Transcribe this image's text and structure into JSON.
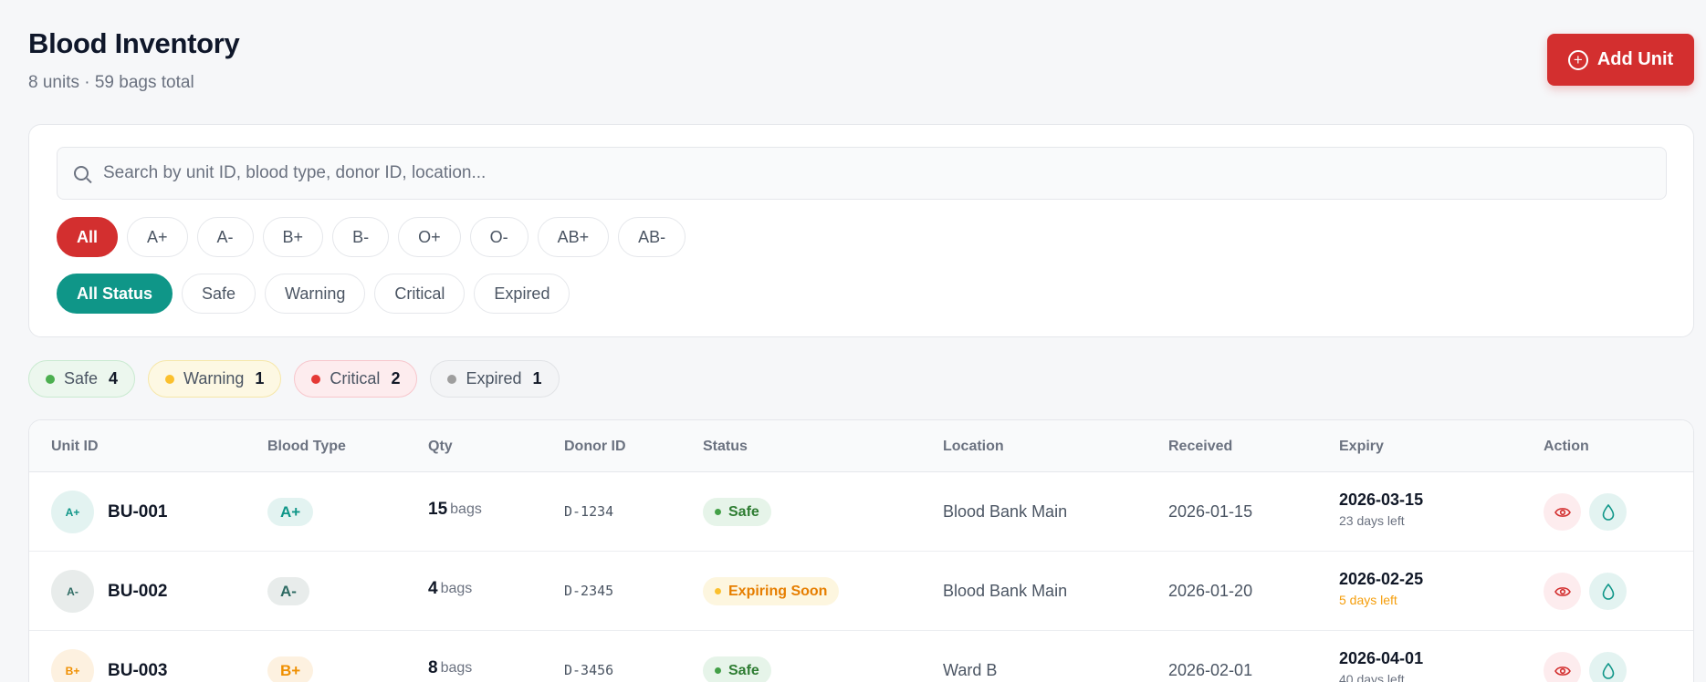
{
  "header": {
    "title": "Blood Inventory",
    "subtitle": "8 units · 59 bags total",
    "add_button": "Add Unit"
  },
  "search": {
    "placeholder": "Search by unit ID, blood type, donor ID, location..."
  },
  "blood_filters": [
    "All",
    "A+",
    "A-",
    "B+",
    "B-",
    "O+",
    "O-",
    "AB+",
    "AB-"
  ],
  "status_filters": [
    "All Status",
    "Safe",
    "Warning",
    "Critical",
    "Expired"
  ],
  "summary": [
    {
      "label": "Safe",
      "count": "4",
      "color": "#4caf50"
    },
    {
      "label": "Warning",
      "count": "1",
      "color": "#fbc02d"
    },
    {
      "label": "Critical",
      "count": "2",
      "color": "#e53935"
    },
    {
      "label": "Expired",
      "count": "1",
      "color": "#9e9e9e"
    }
  ],
  "table": {
    "columns": [
      "Unit ID",
      "Blood Type",
      "Qty",
      "Donor ID",
      "Status",
      "Location",
      "Received",
      "Expiry",
      "Action"
    ],
    "rows": [
      {
        "unit_id": "BU-001",
        "blood_type": "A+",
        "qty": "15",
        "qty_unit": "bags",
        "donor_id": "D-1234",
        "status": "Safe",
        "location": "Blood Bank Main",
        "received": "2026-01-15",
        "expiry": "2026-03-15",
        "days_left": "23 days left"
      },
      {
        "unit_id": "BU-002",
        "blood_type": "A-",
        "qty": "4",
        "qty_unit": "bags",
        "donor_id": "D-2345",
        "status": "Expiring Soon",
        "location": "Blood Bank Main",
        "received": "2026-01-20",
        "expiry": "2026-02-25",
        "days_left": "5 days left"
      },
      {
        "unit_id": "BU-003",
        "blood_type": "B+",
        "qty": "8",
        "qty_unit": "bags",
        "donor_id": "D-3456",
        "status": "Safe",
        "location": "Ward B",
        "received": "2026-02-01",
        "expiry": "2026-04-01",
        "days_left": "40 days left"
      }
    ]
  },
  "colors": {
    "brand_red": "#d32f2f",
    "teal": "#0f9688",
    "warning_orange": "#f59e0b"
  }
}
